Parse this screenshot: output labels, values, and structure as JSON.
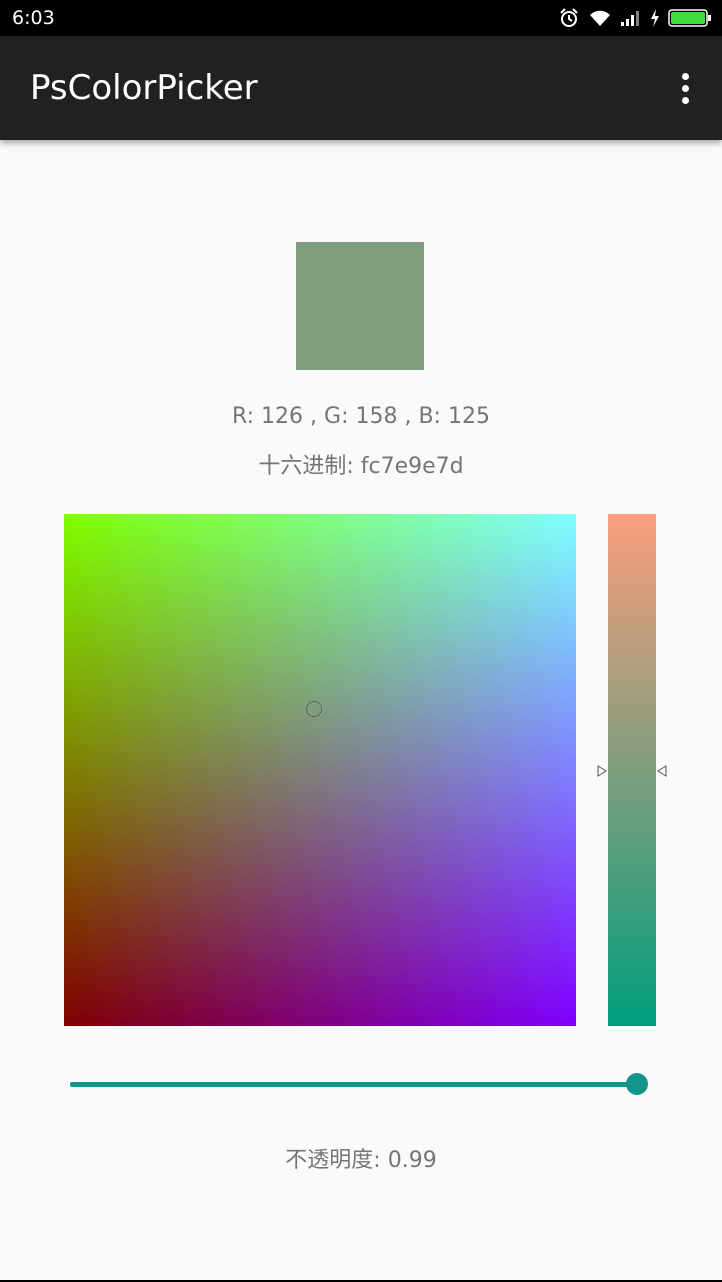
{
  "status_bar": {
    "time": "6:03",
    "icons": [
      "alarm-icon",
      "wifi-icon",
      "signal-icon",
      "charging-icon",
      "battery-icon"
    ]
  },
  "app_bar": {
    "title": "PsColorPicker",
    "menu_icon": "overflow-menu-icon"
  },
  "preview": {
    "color": "#7e9e7d"
  },
  "rgb": {
    "text": "R: 126 , G: 158 , B: 125"
  },
  "hex": {
    "label": "十六进制: ",
    "value": "fc7e9e7d"
  },
  "picker": {
    "square_corners": {
      "top_left": "#7fff00",
      "top_right": "#7fffff",
      "bottom_left": "#7f0000",
      "bottom_right": "#7f00ff"
    },
    "vertical_slider": {
      "top_color": "#fc9e7d",
      "middle_color": "#7e9e7d",
      "bottom_color": "#009e7d",
      "position": 0.5
    }
  },
  "opacity": {
    "label": "不透明度: ",
    "value": "0.99",
    "fraction": 0.99,
    "accent": "#12968c"
  }
}
